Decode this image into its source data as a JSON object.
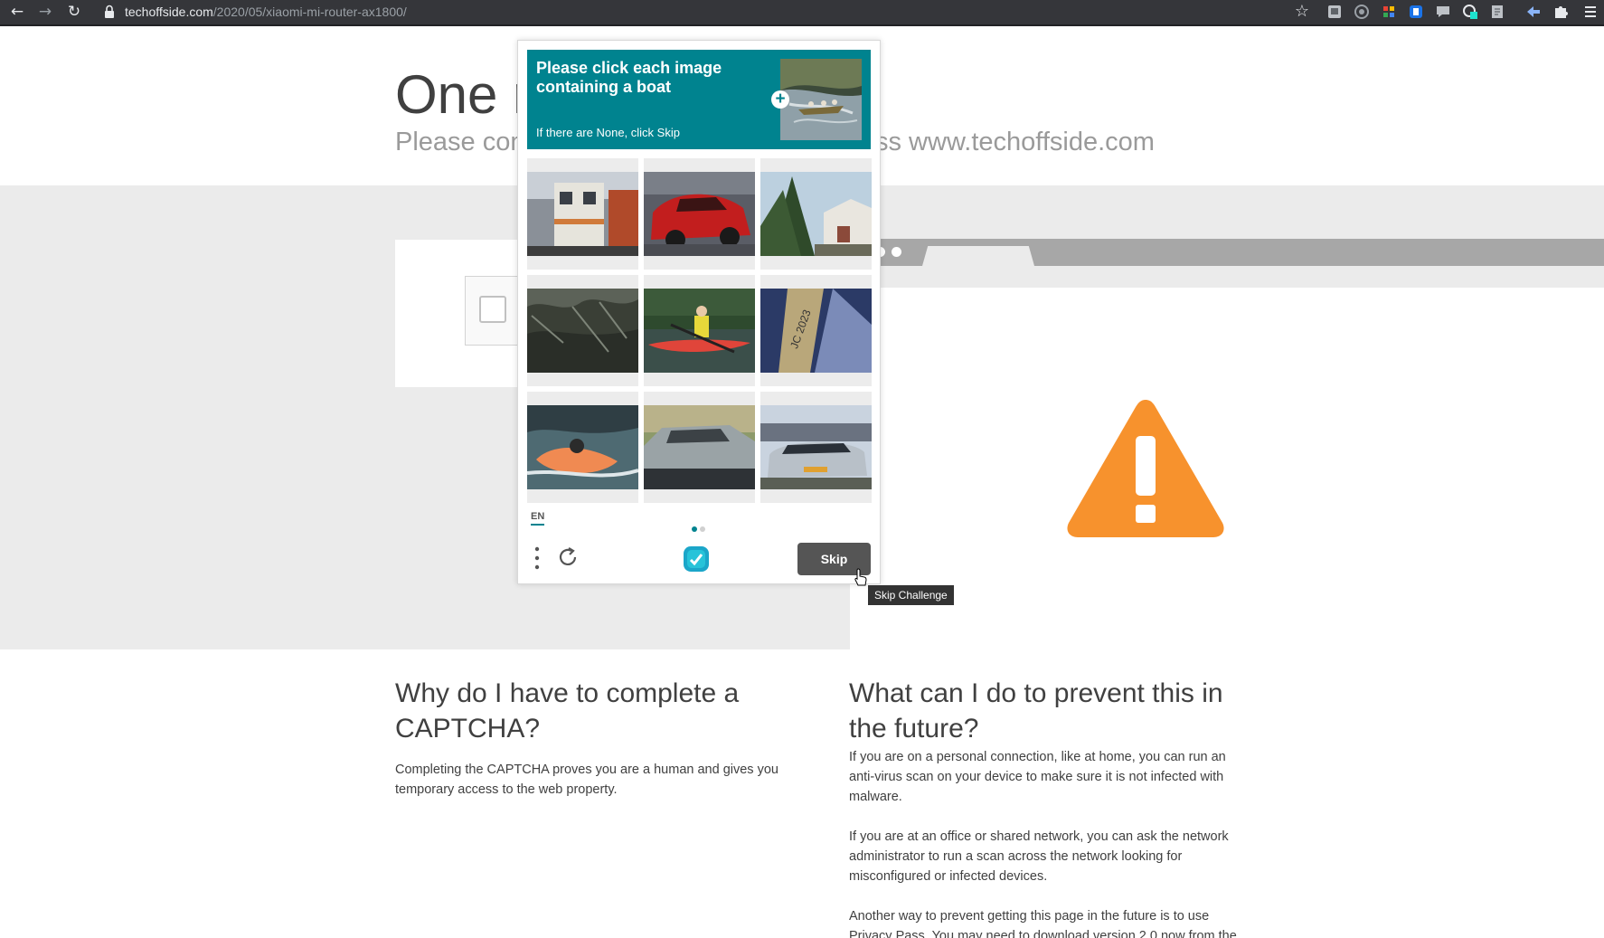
{
  "browser": {
    "back_glyph": "←",
    "forward_glyph": "→",
    "reload_glyph": "↻",
    "url_host": "techoffside.com",
    "url_path": "/2020/05/xiaomi-mi-router-ax1800/",
    "bookmark_glyph": "☆",
    "extension_icons": [
      "ext-square-icon",
      "ext-circle-icon",
      "ext-colorful-icon",
      "ext-blue-icon",
      "ext-chat-icon",
      "ext-green-badge-icon",
      "ext-page-icon",
      "ext-arrow-icon",
      "puzzle-icon",
      "menu-icon"
    ]
  },
  "page": {
    "title_visible": "One r",
    "subtitle_left": "Please com",
    "subtitle_right": "ss www.techoffside.com"
  },
  "captcha": {
    "prompt_title": "Please click each image containing a boat",
    "prompt_hint": "If there are None, click Skip",
    "language": "EN",
    "skip_label": "Skip",
    "tooltip": "Skip Challenge",
    "tiles": [
      "train",
      "red-car",
      "house-tree",
      "trees",
      "kayaker",
      "sail",
      "rafting",
      "silver-car",
      "bmw-car"
    ],
    "accent_color": "#00838f"
  },
  "why": {
    "heading": "Why do I have to complete a CAPTCHA?",
    "body": "Completing the CAPTCHA proves you are a human and gives you temporary access to the web property."
  },
  "prevent": {
    "heading": "What can I do to prevent this in the future?",
    "p1": "If you are on a personal connection, like at home, you can run an anti-virus scan on your device to make sure it is not infected with malware.",
    "p2": "If you are at an office or shared network, you can ask the network administrator to run a scan across the network looking for misconfigured or infected devices.",
    "p3": "Another way to prevent getting this page in the future is to use Privacy Pass. You may need to download version 2.0 now from the"
  },
  "colors": {
    "warning": "#f7922d",
    "band": "#ebebeb"
  }
}
